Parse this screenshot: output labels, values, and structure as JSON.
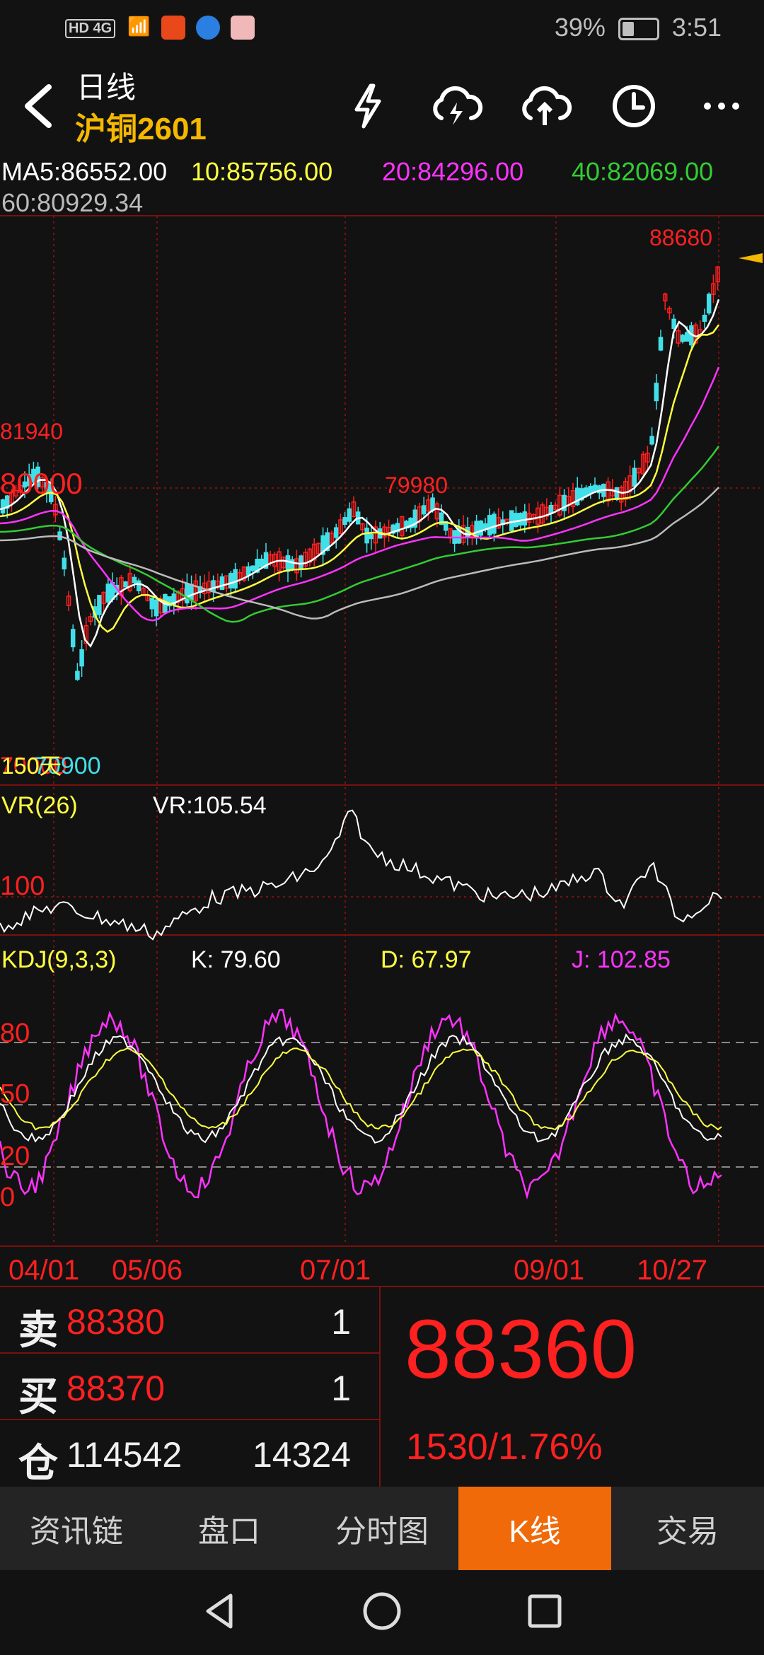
{
  "status": {
    "left": "HD 4G",
    "battery": "39%",
    "time": "3:51"
  },
  "header": {
    "period": "日线",
    "contract": "沪铜2601"
  },
  "ma": {
    "ma5": "MA5:86552.00",
    "ma10": "10:85756.00",
    "ma20": "20:84296.00",
    "ma40": "40:82069.00",
    "ma60": "60:80929.34"
  },
  "price_chart": {
    "high_label": "88680",
    "label_81940": "81940",
    "label_80000": "80000",
    "label_79980": "79980",
    "low_label": "70900",
    "days_label": "150天",
    "axis_low": "70000"
  },
  "vr": {
    "name": "VR(26)",
    "value": "VR:105.54",
    "axis_100": "100"
  },
  "kdj": {
    "name": "KDJ(9,3,3)",
    "k": "K: 79.60",
    "d": "D: 67.97",
    "j": "J: 102.85",
    "axis": [
      "80",
      "50",
      "20",
      "0"
    ]
  },
  "dates": [
    "04/01",
    "05/06",
    "07/01",
    "09/01",
    "10/27"
  ],
  "orderbook": {
    "sell_label": "卖",
    "sell_price": "88380",
    "sell_qty": "1",
    "buy_label": "买",
    "buy_price": "88370",
    "buy_qty": "1",
    "oi_label": "仓",
    "open_interest": "114542",
    "oi_change": "14324",
    "last_price": "88360",
    "change": "1530/1.76%"
  },
  "tabs": [
    "资讯链",
    "盘口",
    "分时图",
    "K线",
    "交易"
  ],
  "active_tab": 3,
  "colors": {
    "up": "#ff2020",
    "down": "#40e0e8",
    "ma5": "#ffffff",
    "ma10": "#ffff40",
    "ma20": "#ff33ff",
    "ma40": "#33cc33",
    "ma60": "#bbbbbb",
    "accent": "#f06a0a",
    "contract": "#f5b800"
  }
}
